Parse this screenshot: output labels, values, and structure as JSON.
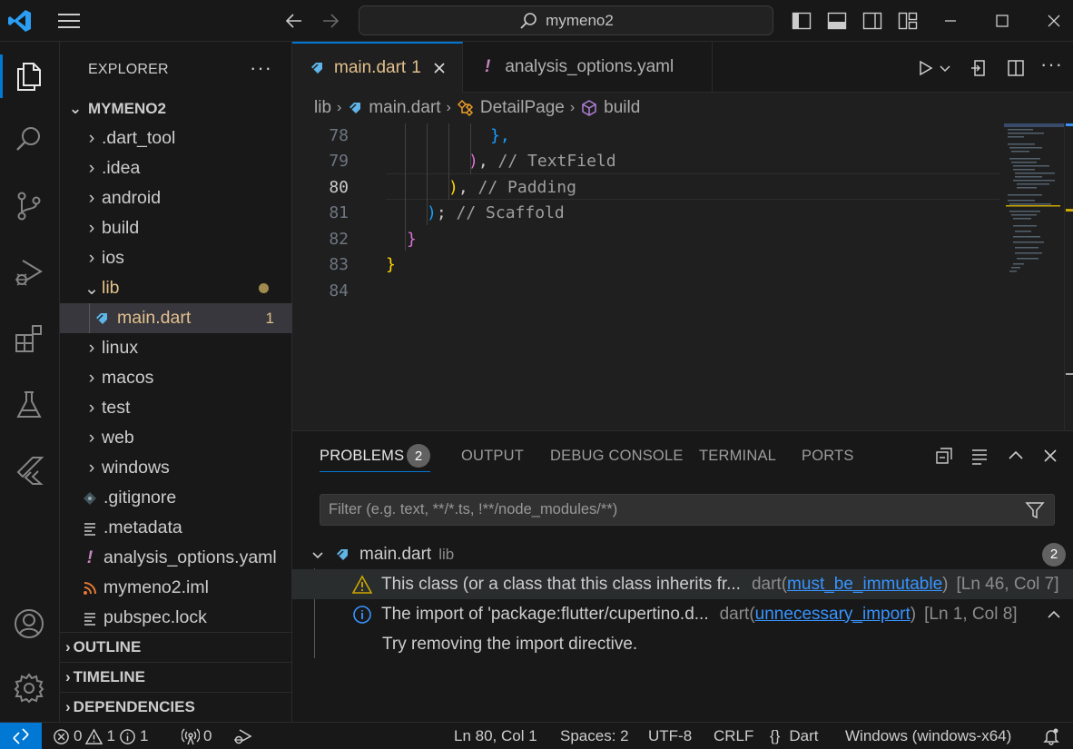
{
  "titlebar": {
    "search_text": "mymeno2"
  },
  "explorer": {
    "title": "EXPLORER",
    "root": "MYMENO2",
    "items": [
      {
        "label": ".dart_tool"
      },
      {
        "label": ".idea"
      },
      {
        "label": "android"
      },
      {
        "label": "build"
      },
      {
        "label": "ios"
      },
      {
        "label": "lib"
      },
      {
        "label": "main.dart",
        "badge": "1"
      },
      {
        "label": "linux"
      },
      {
        "label": "macos"
      },
      {
        "label": "test"
      },
      {
        "label": "web"
      },
      {
        "label": "windows"
      },
      {
        "label": ".gitignore"
      },
      {
        "label": ".metadata"
      },
      {
        "label": "analysis_options.yaml"
      },
      {
        "label": "mymeno2.iml"
      },
      {
        "label": "pubspec.lock"
      }
    ],
    "sections": [
      "OUTLINE",
      "TIMELINE",
      "DEPENDENCIES"
    ]
  },
  "tabs": [
    {
      "label": "main.dart",
      "badge": "1"
    },
    {
      "label": "analysis_options.yaml"
    }
  ],
  "breadcrumb": [
    "lib",
    "main.dart",
    "DetailPage",
    "build"
  ],
  "code": {
    "line_numbers": [
      "78",
      "79",
      "80",
      "81",
      "82",
      "83",
      "84"
    ],
    "l78": "},",
    "l79_paren": ")",
    "l79_comma": ",",
    "l79_comment": "// TextField",
    "l80_paren": ")",
    "l80_comma": ",",
    "l80_comment": "// Padding",
    "l81_paren": ")",
    "l81_semi": ";",
    "l81_comment": "// Scaffold",
    "l82": "}",
    "l83": "}"
  },
  "panel": {
    "tabs": [
      "PROBLEMS",
      "OUTPUT",
      "DEBUG CONSOLE",
      "TERMINAL",
      "PORTS"
    ],
    "problems_count": "2",
    "filter_placeholder": "Filter (e.g. text, **/*.ts, !**/node_modules/**)",
    "file": {
      "name": "main.dart",
      "folder": "lib",
      "count": "2"
    },
    "problems": [
      {
        "message": "This class (or a class that this class inherits fr...",
        "source": "dart",
        "code": "must_be_immutable",
        "location": "[Ln 46, Col 7]"
      },
      {
        "message": "The import of 'package:flutter/cupertino.d...",
        "source": "dart",
        "code": "unnecessary_import",
        "location": "[Ln 1, Col 8]",
        "detail": "Try removing the import directive."
      }
    ]
  },
  "status": {
    "errors": "0",
    "warnings": "1",
    "infos": "1",
    "ports": "0",
    "position": "Ln 80, Col 1",
    "spaces": "Spaces: 2",
    "encoding": "UTF-8",
    "eol": "CRLF",
    "language_braces": "{}",
    "language": "Dart",
    "platform": "Windows (windows-x64)"
  },
  "colors": {
    "accent": "#0078d4",
    "modified": "#e2c08d",
    "warning": "#cca700",
    "info": "#3794ff"
  }
}
